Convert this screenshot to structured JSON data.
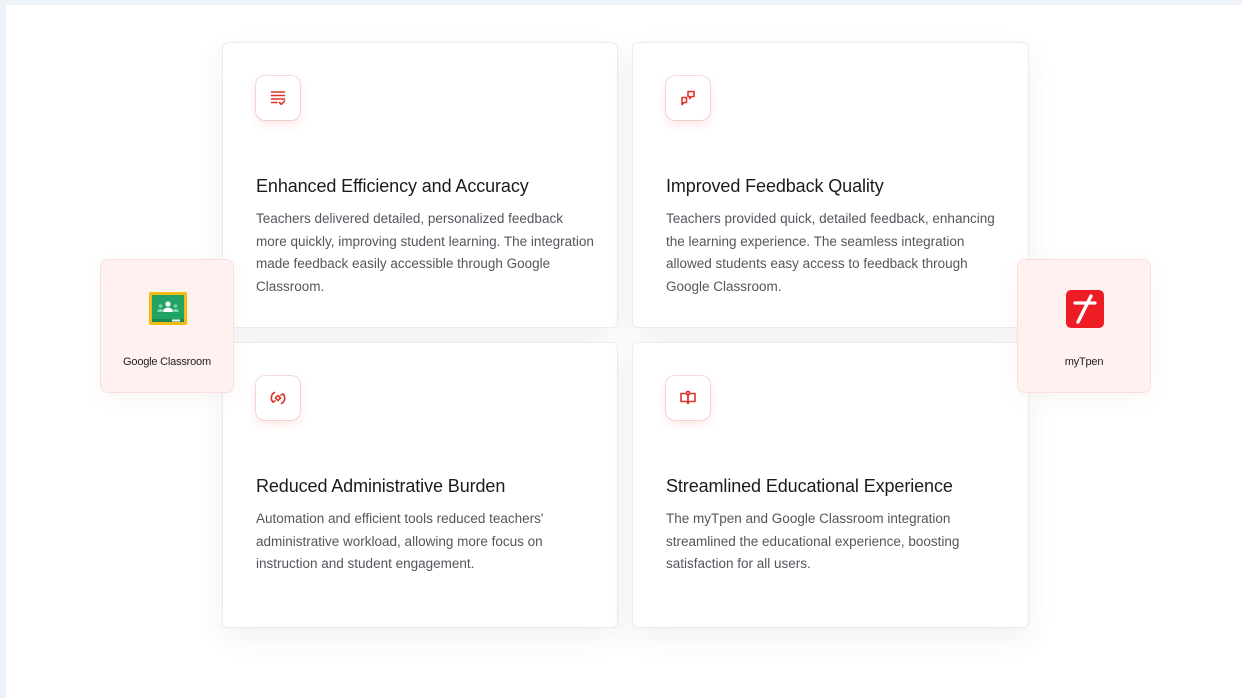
{
  "accent_color": "#e0332a",
  "cards": [
    {
      "icon": "checklist-icon",
      "title": "Enhanced Efficiency and Accuracy",
      "text": "Teachers delivered detailed, personalized feedback more quickly, improving student learning. The integration made feedback easily accessible through Google Classroom."
    },
    {
      "icon": "chat-bubbles-icon",
      "title": "Improved Feedback Quality",
      "text": "Teachers provided quick, detailed feedback, enhancing the learning experience. The seamless integration allowed students easy access to feedback through Google Classroom."
    },
    {
      "icon": "sync-icon",
      "title": "Reduced Administrative Burden",
      "text": "Automation and efficient tools reduced teachers' administrative workload, allowing more focus on instruction and student engagement."
    },
    {
      "icon": "open-book-icon",
      "title": "Streamlined Educational Experience",
      "text": "The myTpen and Google Classroom integration streamlined the educational experience, boosting satisfaction for all users."
    }
  ],
  "integrations": {
    "left": {
      "label": "Google Classroom",
      "icon": "google-classroom-logo"
    },
    "right": {
      "label": "myTpen",
      "icon": "mytpen-logo"
    }
  }
}
